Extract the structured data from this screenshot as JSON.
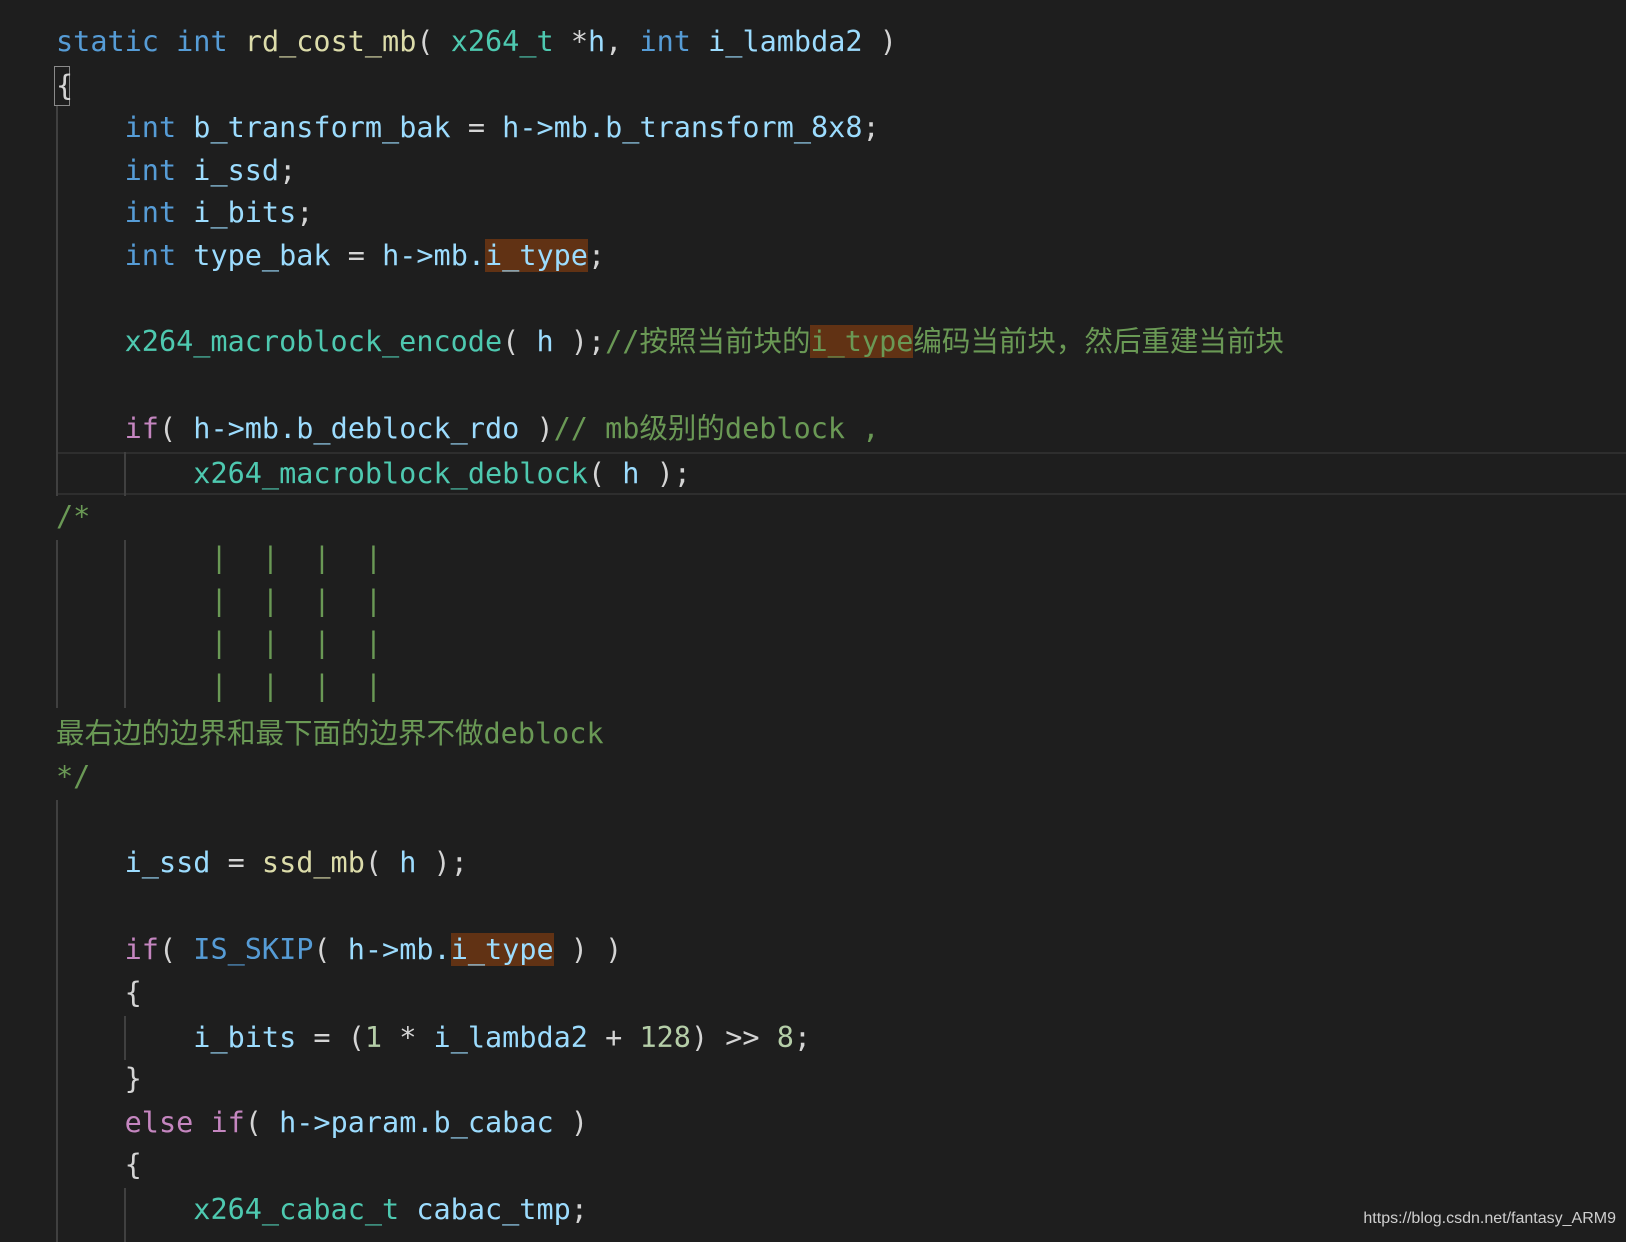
{
  "code": {
    "sig_static": "static",
    "sig_int": "int",
    "sig_fn": "rd_cost_mb",
    "sig_open": "( ",
    "sig_type": "x264_t",
    "sig_star": " *",
    "sig_h": "h",
    "sig_comma": ", ",
    "sig_int2": "int",
    "sig_param": "i_lambda2",
    "sig_close": " )",
    "open_brace": "{",
    "l1_kw": "int",
    "l1_var": "b_transform_bak",
    "l1_eq": " = ",
    "l1_rhs": "h->mb.b_transform_8x8",
    "l1_end": ";",
    "l2_kw": "int",
    "l2_var": "i_ssd",
    "l2_end": ";",
    "l3_kw": "int",
    "l3_var": "i_bits",
    "l3_end": ";",
    "l4_kw": "int",
    "l4_var": "type_bak",
    "l4_eq": " = ",
    "l4_rhs": "h->mb.",
    "l4_hl": "i_type",
    "l4_end": ";",
    "enc_fn": "x264_macroblock_encode",
    "enc_open": "( ",
    "enc_arg": "h",
    "enc_close": " );",
    "enc_cm1": "//按照当前块的",
    "enc_hl": "i_type",
    "enc_cm2": "编码当前块，然后重建当前块",
    "if1_kw": "if",
    "if1_open": "( ",
    "if1_cond": "h->mb.b_deblock_rdo",
    "if1_close": " )",
    "if1_cm": "// mb级别的deblock ,",
    "db_fn": "x264_macroblock_deblock",
    "db_open": "( ",
    "db_arg": "h",
    "db_close": " );",
    "bc_open": "/*",
    "bc_bars": "|  |  |  |",
    "bc_text": "最右边的边界和最下面的边界不做deblock",
    "bc_close": "*/",
    "ssd_var": "i_ssd",
    "ssd_eq": " = ",
    "ssd_fn": "ssd_mb",
    "ssd_open": "( ",
    "ssd_arg": "h",
    "ssd_close": " );",
    "if2_kw": "if",
    "if2_open": "( ",
    "if2_macro": "IS_SKIP",
    "if2_open2": "( ",
    "if2_arg": "h->mb.",
    "if2_hl": "i_type",
    "if2_close": " ) )",
    "brace_open": "{",
    "bits_var": "i_bits",
    "bits_eq": " = (",
    "bits_n1": "1",
    "bits_mul": " * ",
    "bits_lambda": "i_lambda2",
    "bits_plus": " + ",
    "bits_n2": "128",
    "bits_shift": ") >> ",
    "bits_n3": "8",
    "bits_end": ";",
    "brace_close": "}",
    "else_kw": "else",
    "else_if_kw": "if",
    "else_open": "( ",
    "else_cond": "h->param.b_cabac",
    "else_close": " )",
    "brace_open2": "{",
    "cabac_type": "x264_cabac_t",
    "cabac_var": "cabac_tmp",
    "cabac_end": ";"
  },
  "watermark": "https://blog.csdn.net/fantasy_ARM9"
}
